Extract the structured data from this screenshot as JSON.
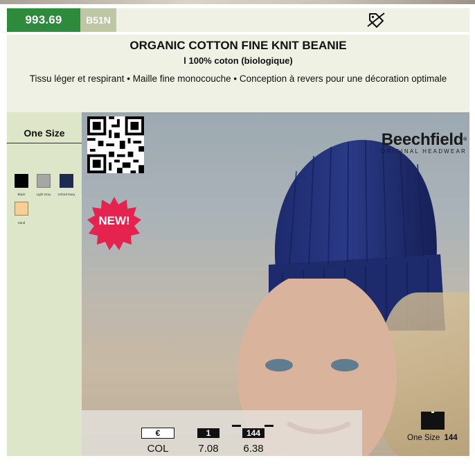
{
  "header": {
    "price": "993.69",
    "code": "B51N",
    "tag_icon": "discount-tag-icon"
  },
  "product": {
    "title": "ORGANIC COTTON FINE KNIT BEANIE",
    "subtitle": "l 100% coton (biologique)",
    "description": "Tissu léger et respirant • Maille fine monocouche • Conception à revers pour une décoration optimale"
  },
  "sizes": {
    "label": "One Size"
  },
  "colors": [
    {
      "name": "Black",
      "hex": "#000000"
    },
    {
      "name": "Light Grey",
      "hex": "#a6a6a6"
    },
    {
      "name": "Oxford Navy",
      "hex": "#1f2a52"
    },
    {
      "name": "Sand",
      "hex": "#f6cf94"
    }
  ],
  "brand": {
    "name": "Beechfield",
    "registered": "®",
    "tagline": "ORIGINAL HEADWEAR"
  },
  "badge": {
    "new_label": "NEW!",
    "color": "#e4234f"
  },
  "pricing": {
    "currency_label": "€",
    "col_label": "COL",
    "tiers": [
      {
        "qty": "1",
        "price": "7.08"
      },
      {
        "qty": "144",
        "price": "6.38"
      }
    ]
  },
  "stock": {
    "size": "One Size",
    "qty": "144"
  },
  "accent_colors": {
    "price_green": "#2e8b3c",
    "code_olive": "#bfc6a3",
    "panel_bg": "#dde6c8",
    "title_bg": "#eef1e3"
  }
}
